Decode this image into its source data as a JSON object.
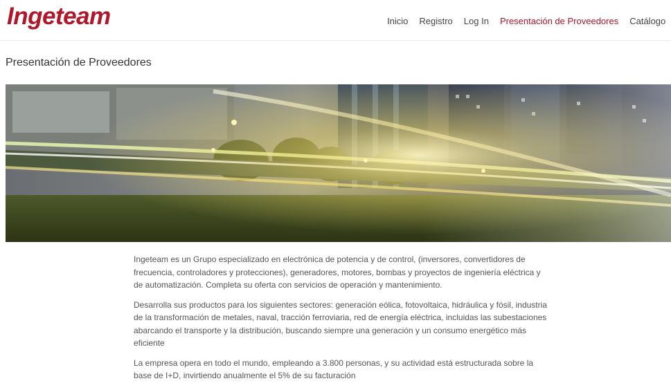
{
  "header": {
    "logo_text": "Ingeteam",
    "nav": [
      {
        "label": "Inicio",
        "active": false
      },
      {
        "label": "Registro",
        "active": false
      },
      {
        "label": "Log In",
        "active": false
      },
      {
        "label": "Presentación de Proveedores",
        "active": true
      },
      {
        "label": "Catálogo",
        "active": false
      }
    ]
  },
  "main": {
    "title": "Presentación de Proveedores",
    "paragraphs": [
      "Ingeteam es un Grupo especializado en electrónica de potencia y de control, (inversores, convertidores de frecuencia, controladores y protecciones), generadores, motores, bombas y proyectos de ingeniería eléctrica y de automatización. Completa su oferta con servicios de operación y mantenimiento.",
      "Desarrolla sus productos para los siguientes sectores: generación eólica, fotovoltaica, hidráulica y fósil, industria de la transformación de metales, naval, tracción ferroviaria, red de energía eléctrica, incluidas las subestaciones abarcando el transporte y la distribución, buscando siempre una generación y un consumo energético más eficiente",
      "La empresa opera en todo el mundo, empleando a 3.800 personas, y su actividad está estructurada sobre la base de I+D, invirtiendo anualmente el 5% de su facturación"
    ]
  },
  "colors": {
    "brand": "#b0172a",
    "nav_active": "#a8152b",
    "nav_text": "#444444",
    "body_text": "#555555"
  }
}
